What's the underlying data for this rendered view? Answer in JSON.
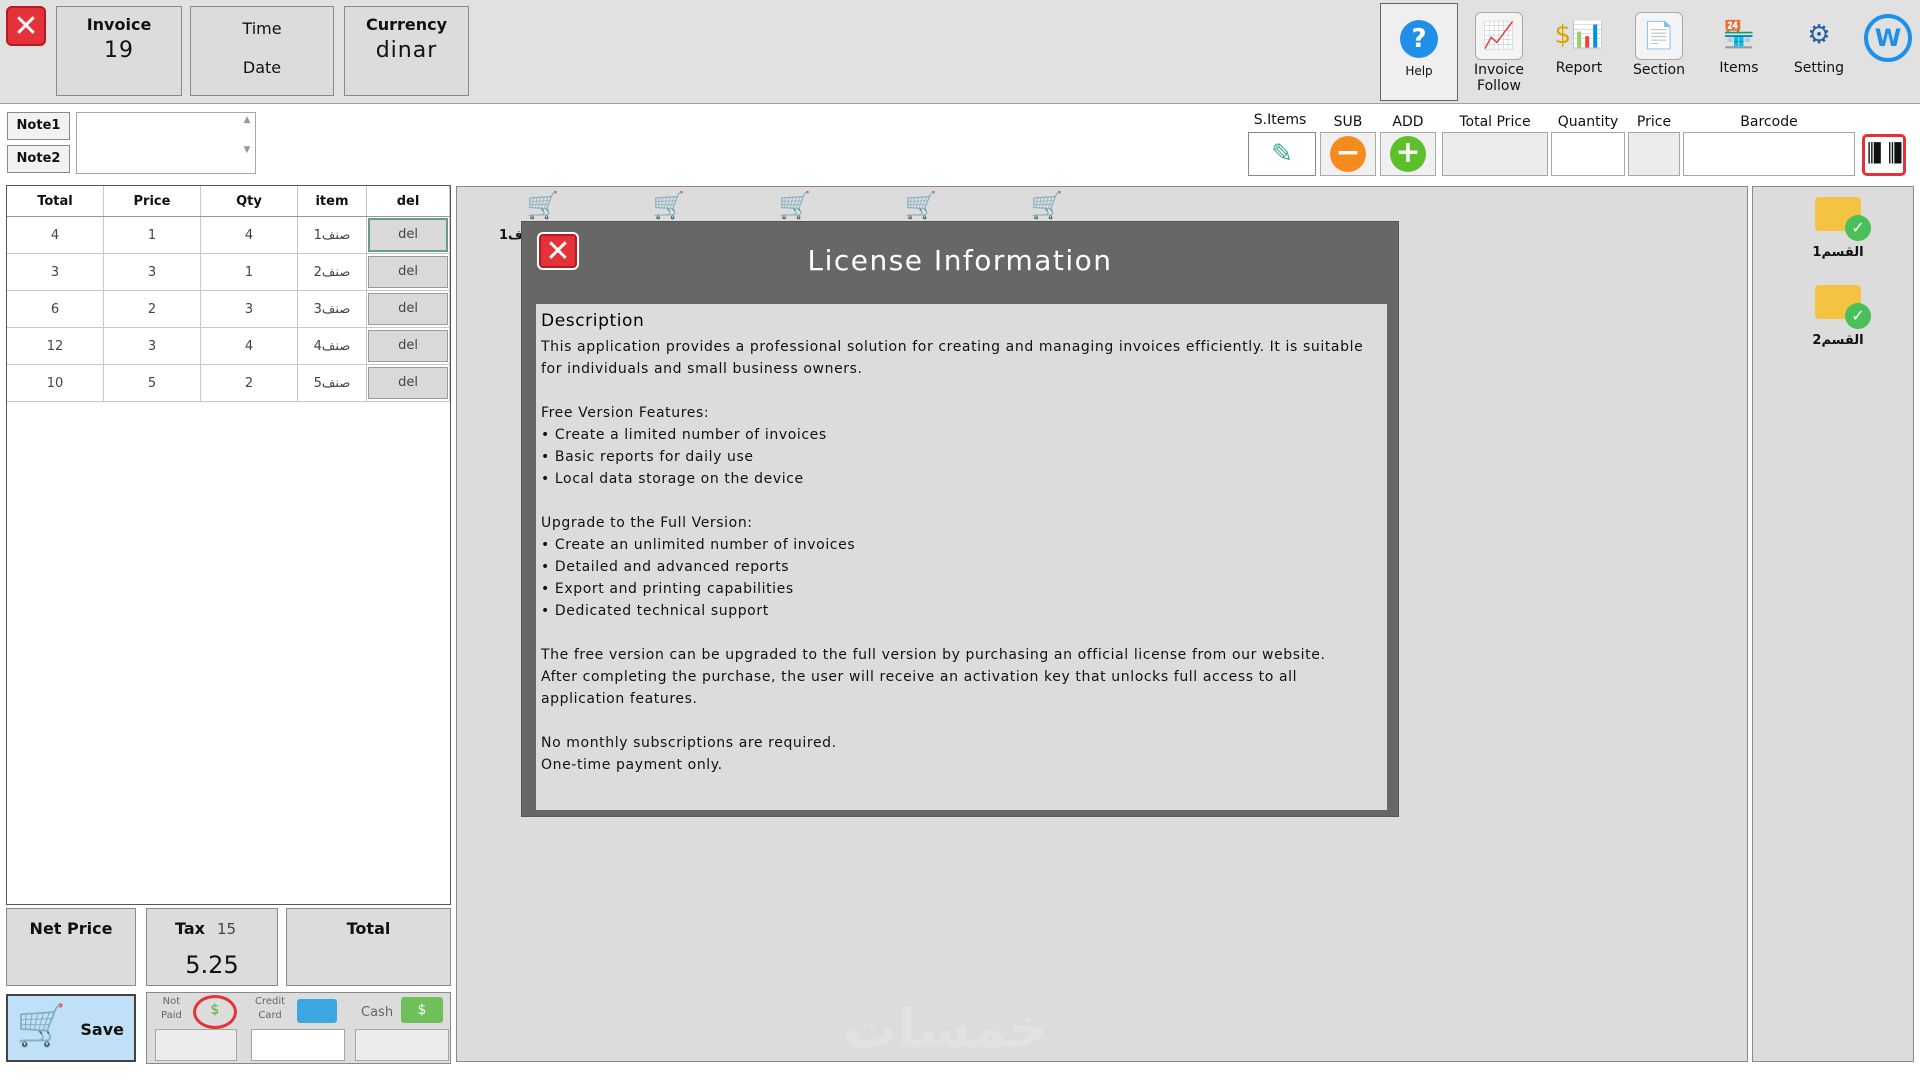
{
  "header": {
    "invoice_label": "Invoice",
    "invoice_value": "19",
    "time_label": "Time",
    "date_label": "Date",
    "currency_label": "Currency",
    "currency_value": "dinar"
  },
  "toolbar": {
    "help": "Help",
    "invoice_follow_1": "Invoice",
    "invoice_follow_2": "Follow",
    "report": "Report",
    "section": "Section",
    "items": "Items",
    "setting": "Setting"
  },
  "notes": {
    "note1": "Note1",
    "note2": "Note2"
  },
  "entry": {
    "s_items": "S.Items",
    "sub": "SUB",
    "add": "ADD",
    "total_price": "Total Price",
    "quantity": "Quantity",
    "price": "Price",
    "barcode": "Barcode"
  },
  "table": {
    "headers": [
      "Total",
      "Price",
      "Qty",
      "item",
      "del"
    ],
    "rows": [
      {
        "total": "4",
        "price": "1",
        "qty": "4",
        "item": "صنف1",
        "del": "del"
      },
      {
        "total": "3",
        "price": "3",
        "qty": "1",
        "item": "صنف2",
        "del": "del"
      },
      {
        "total": "6",
        "price": "2",
        "qty": "3",
        "item": "صنف3",
        "del": "del"
      },
      {
        "total": "12",
        "price": "3",
        "qty": "4",
        "item": "صنف4",
        "del": "del"
      },
      {
        "total": "10",
        "price": "5",
        "qty": "2",
        "item": "صنف5",
        "del": "del"
      }
    ]
  },
  "summary": {
    "net_price_label": "Net Price",
    "tax_label": "Tax",
    "tax_rate": "15",
    "tax_value": "5.25",
    "total_label": "Total"
  },
  "payment": {
    "save": "Save",
    "not_paid_1": "Not",
    "not_paid_2": "Paid",
    "credit_1": "Credit",
    "credit_2": "Card",
    "cash": "Cash"
  },
  "sections": [
    {
      "label": "القسم1"
    },
    {
      "label": "القسم2"
    }
  ],
  "product_label_fragment": "1ف",
  "watermark": "خمسات",
  "modal": {
    "title": "License Information",
    "heading": "Description",
    "paragraphs": [
      "This application provides a professional solution for creating and managing invoices efficiently. It is suitable for individuals and small business owners.",
      "",
      "Free Version Features:",
      "• Create a limited number of invoices",
      "• Basic reports for daily use",
      "• Local data storage on the device",
      "",
      "Upgrade to the Full Version:",
      "• Create an unlimited number of invoices",
      "• Detailed and advanced reports",
      "• Export and printing capabilities",
      "• Dedicated technical support",
      "",
      "The free version can be upgraded to the full version by purchasing an official license from our website.",
      "After completing the purchase, the user will receive an activation key that unlocks full access to all application features.",
      "",
      "No monthly subscriptions are required.",
      "One-time payment only."
    ]
  },
  "colors": {
    "close_red": "#e5323a",
    "help_blue": "#1f8fe8",
    "sub_orange": "#f58a1f",
    "add_green": "#5cc02a",
    "modal_header": "#676767",
    "save_bg": "#bfe0f6"
  }
}
